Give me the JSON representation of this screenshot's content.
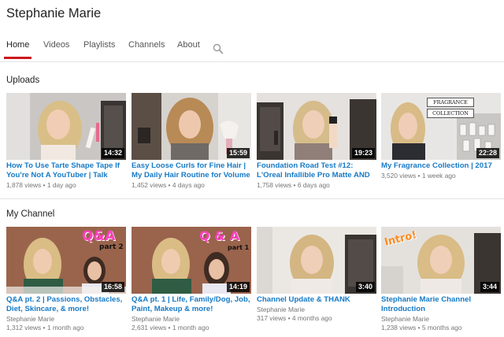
{
  "channel": {
    "title": "Stephanie Marie"
  },
  "tabs": [
    {
      "label": "Home",
      "active": true
    },
    {
      "label": "Videos",
      "active": false
    },
    {
      "label": "Playlists",
      "active": false
    },
    {
      "label": "Channels",
      "active": false
    },
    {
      "label": "About",
      "active": false
    }
  ],
  "icons": {
    "search": "search-icon"
  },
  "colors": {
    "accent": "#cc181e",
    "link": "#167ac6"
  },
  "uploads": {
    "title": "Uploads",
    "videos": [
      {
        "title": "How To Use Tarte Shape Tape If You're Not A YouTuber | Talk",
        "views": "1,878 views",
        "age": "1 day ago",
        "duration": "14:32"
      },
      {
        "title": "Easy Loose Curls for Fine Hair | My Daily Hair Routine for Volume",
        "views": "1,452 views",
        "age": "4 days ago",
        "duration": "15:59"
      },
      {
        "title": "Foundation Road Test #12: L'Oreal Infallible Pro Matte AND",
        "views": "1,758 views",
        "age": "6 days ago",
        "duration": "19:23"
      },
      {
        "title": "My Fragrance Collection | 2017",
        "views": "3,520 views",
        "age": "1 week ago",
        "duration": "22:28",
        "overlay": "FRAGRANCE\nCOLLECTION"
      }
    ]
  },
  "my_channel": {
    "title": "My Channel",
    "videos": [
      {
        "title": "Q&A pt. 2 | Passions, Obstacles, Diet, Skincare, & more!",
        "channel": "Stephanie Marie",
        "views": "1,312 views",
        "age": "1 month ago",
        "duration": "16:58",
        "overlay": "Q&A",
        "overlay_sub": "part 2"
      },
      {
        "title": "Q&A pt. 1 | Life, Family/Dog, Job, Paint, Makeup & more!",
        "channel": "Stephanie Marie",
        "views": "2,631 views",
        "age": "1 month ago",
        "duration": "14:19",
        "overlay": "Q & A",
        "overlay_sub": "part 1"
      },
      {
        "title": "Channel Update & THANK YOU!!!!",
        "channel": "Stephanie Marie",
        "views": "317 views",
        "age": "4 months ago",
        "duration": "3:40"
      },
      {
        "title": "Stephanie Marie Channel Introduction",
        "channel": "Stephanie Marie",
        "views": "1,238 views",
        "age": "5 months ago",
        "duration": "3:44",
        "overlay": "Intro!"
      }
    ]
  }
}
